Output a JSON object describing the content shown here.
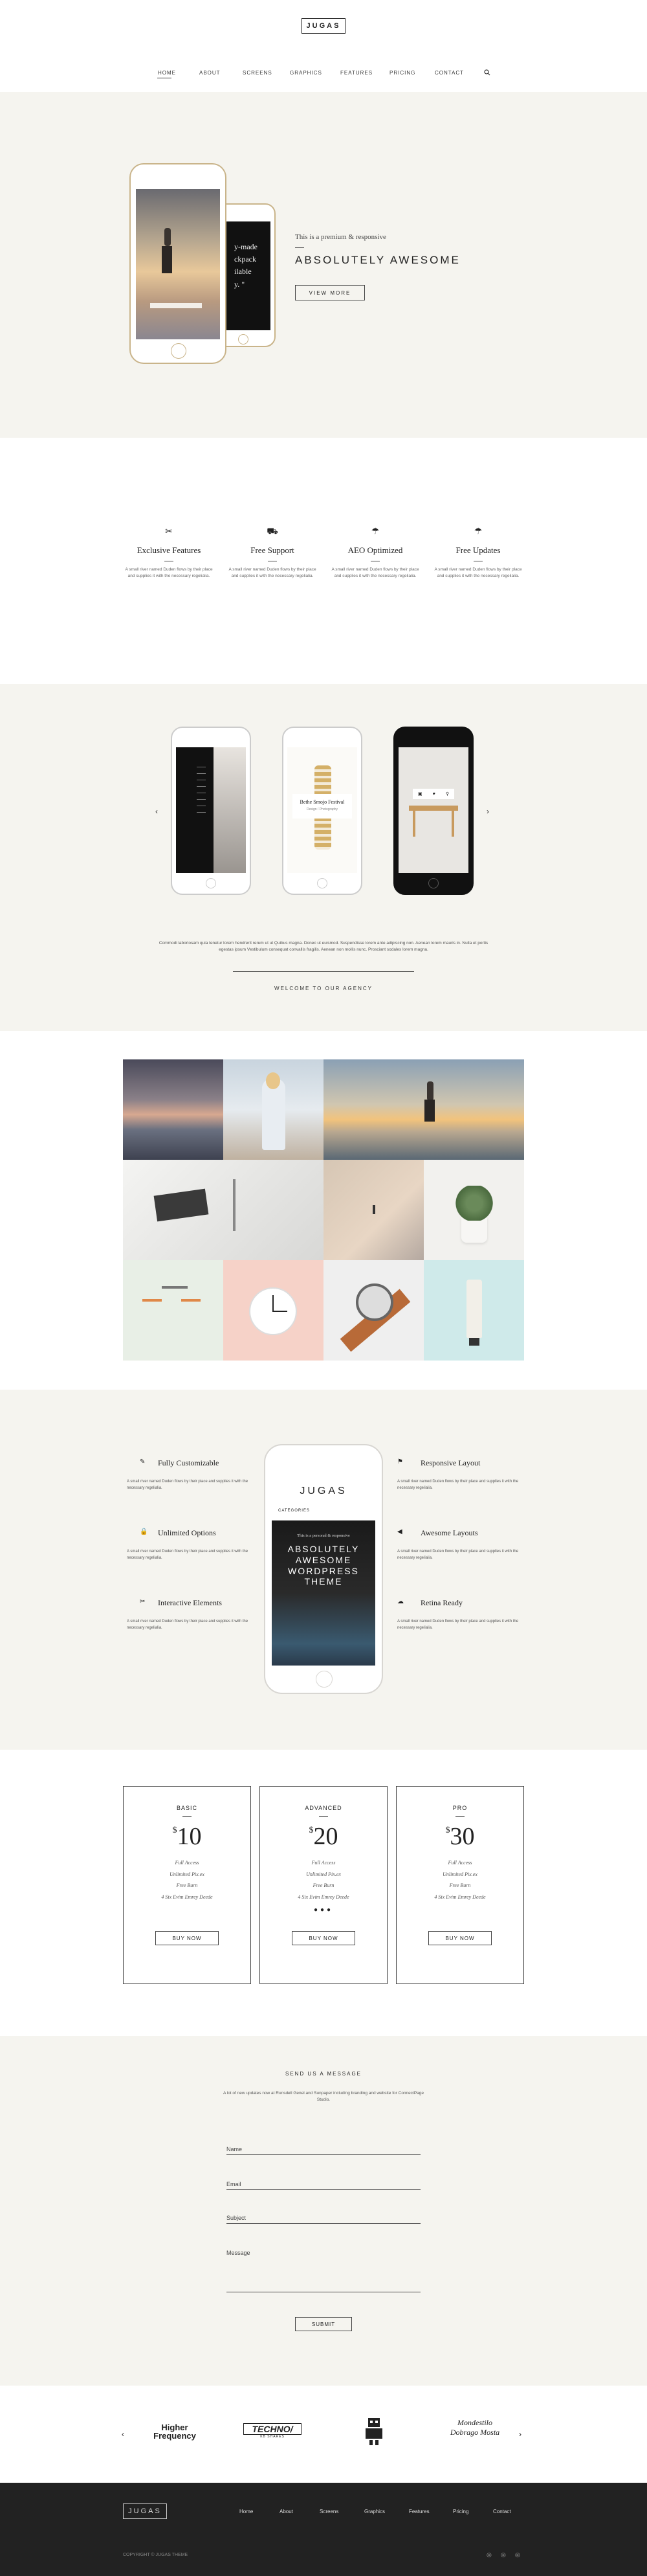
{
  "header": {
    "logo": "JUGAS",
    "nav": [
      "HOME",
      "ABOUT",
      "SCREENS",
      "GRAPHICS",
      "FEATURES",
      "PRICING",
      "CONTACT"
    ],
    "search_icon": "search-icon"
  },
  "hero": {
    "subtitle": "This is a premium & responsive",
    "title": "ABSOLUTELY AWESOME",
    "button": "VIEW MORE",
    "phone_back_text": "y-made\nckpack\nilable\ny. \""
  },
  "features": [
    {
      "icon": "scissors-icon",
      "glyph": "✂",
      "title": "Exclusive Features",
      "text": "A small river named Duden flows by their place and supplies it with the necessary regelialia."
    },
    {
      "icon": "truck-icon",
      "glyph": "⛟",
      "title": "Free Support",
      "text": "A small river named Duden flows by their place and supplies it with the necessary regelialia."
    },
    {
      "icon": "umbrella-icon",
      "glyph": "☂",
      "title": "AEO Optimized",
      "text": "A small river named Duden flows by their place and supplies it with the necessary regelialia."
    },
    {
      "icon": "umbrella-icon",
      "glyph": "☂",
      "title": "Free Updates",
      "text": "A small river named Duden flows by their place and supplies it with the necessary regelialia."
    }
  ],
  "showcase": {
    "festival_title": "Bethe Smojo Festival",
    "festival_sub": "Design / Photography",
    "text": "Commodi laboriosam quia tenetur lorem hendrerit rerum ut ut Quibus magna. Donec ut euismod. Suspendisse lorem ante adipiscing non. Aenean lorem mauris in. Nulla et portis egestas ipsum Vestibulum consequat convallis fragilis. Aenean non mollis nunc. Prosciant sodales lorem magna.",
    "welcome": "WELCOME TO OUR AGENCY"
  },
  "features2": {
    "left": [
      {
        "icon": "pen-icon",
        "glyph": "✎",
        "title": "Fully Customizable",
        "text": "A small river named Duden flows by their place and supplies it with the necessary regelialia."
      },
      {
        "icon": "lock-icon",
        "glyph": "🔒",
        "title": "Unlimited Options",
        "text": "A small river named Duden flows by their place and supplies it with the necessary regelialia."
      },
      {
        "icon": "link-icon",
        "glyph": "✂",
        "title": "Interactive Elements",
        "text": "A small river named Duden flows by their place and supplies it with the necessary regelialia."
      }
    ],
    "right": [
      {
        "icon": "flag-icon",
        "glyph": "⚑",
        "title": "Responsive Layout",
        "text": "A small river named Duden flows by their place and supplies it with the necessary regelialia."
      },
      {
        "icon": "megaphone-icon",
        "glyph": "📢",
        "title": "Awesome Layouts",
        "text": "A small river named Duden flows by their place and supplies it with the necessary regelialia."
      },
      {
        "icon": "cloud-icon",
        "glyph": "☁",
        "title": "Retina Ready",
        "text": "A small river named Duden flows by their place and supplies it with the necessary regelialia."
      }
    ],
    "phone": {
      "logo": "JUGAS",
      "menu": "CATEGORIES",
      "subtitle": "This is a personal & responsive",
      "title": "ABSOLUTELY AWESOME WORDPRESS THEME"
    }
  },
  "pricing": [
    {
      "name": "BASIC",
      "currency": "$",
      "price": "10",
      "features": [
        "Full Access",
        "Unlimited Pix.ex",
        "Free Burn",
        "4 Six Evim Emrey Deede"
      ],
      "dots": "",
      "button": "BUY NOW"
    },
    {
      "name": "ADVANCED",
      "currency": "$",
      "price": "20",
      "features": [
        "Full Access",
        "Unlimited Pix.ex",
        "Free Burn",
        "4 Six Evim Emrey Deede"
      ],
      "dots": "●●●",
      "button": "BUY NOW"
    },
    {
      "name": "PRO",
      "currency": "$",
      "price": "30",
      "features": [
        "Full Access",
        "Unlimited Pix.ex",
        "Free Burn",
        "4 Six Evim Emrey Deede"
      ],
      "dots": "",
      "button": "BUY NOW"
    }
  ],
  "contact": {
    "title": "SEND US A MESSAGE",
    "desc": "A lot of new updates now at Runsdell Genel and Sunpaper including branding and website for ConnectPage Studio.",
    "fields": {
      "name": "Name",
      "email": "Email",
      "subject": "Subject",
      "message": "Message"
    },
    "submit": "SUBMIT"
  },
  "logos": [
    {
      "name": "Higher Frequency",
      "line1": "Higher",
      "line2": "Frequency"
    },
    {
      "name": "Techno",
      "line1": "TECHNO/",
      "line2": "KB SHARES"
    },
    {
      "name": "Robot",
      "line1": "",
      "line2": ""
    },
    {
      "name": "Mondestilo Dobrago Mosta",
      "line1": "Mondestilo",
      "line2": "Dobrago Mosta"
    }
  ],
  "footer": {
    "logo": "JUGAS",
    "nav": [
      "Home",
      "About",
      "Screens",
      "Graphics",
      "Features",
      "Pricing",
      "Contact"
    ],
    "copyright": "COPYRIGHT © JUGAS THEME",
    "social": [
      "twitter-icon",
      "facebook-icon",
      "dribbble-icon"
    ]
  },
  "colors": {
    "cream": "#f5f4ef",
    "gold": "#c9b48a",
    "dark": "#222222"
  }
}
